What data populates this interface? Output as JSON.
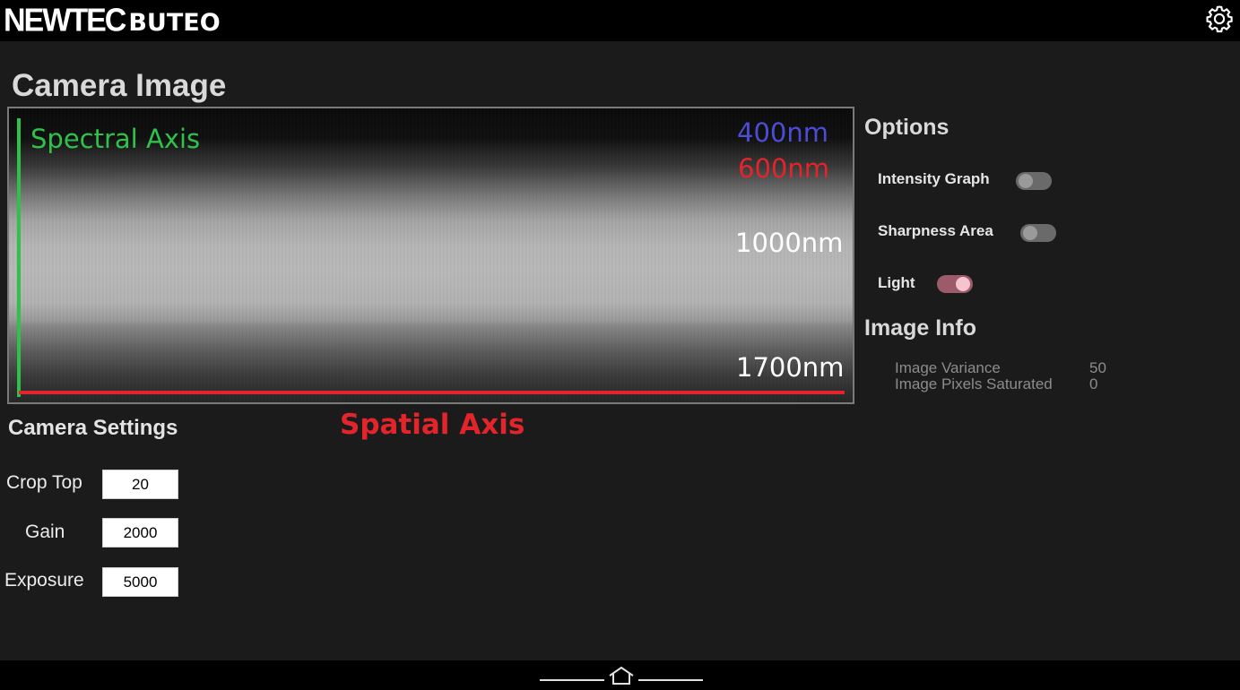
{
  "header": {
    "brand": "NEWTEC",
    "product": "BUTEO",
    "settings_icon": "gear-icon"
  },
  "camera_image": {
    "title": "Camera Image",
    "overlay": {
      "spectral_axis": "Spectral Axis",
      "spatial_axis": "Spatial Axis",
      "wavelengths": [
        "400nm",
        "600nm",
        "1000nm",
        "1700nm"
      ]
    },
    "colors": {
      "spectral_axis": "#2fc24a",
      "spatial_axis": "#e3242b",
      "nm400": "#4b4dd6",
      "nm600": "#e3242b",
      "nm_other": "#ffffff"
    }
  },
  "options": {
    "title": "Options",
    "items": [
      {
        "label": "Intensity Graph",
        "on": false
      },
      {
        "label": "Sharpness Area",
        "on": false
      },
      {
        "label": "Light",
        "on": true
      }
    ],
    "accent_color": "#9c5a6a"
  },
  "image_info": {
    "title": "Image Info",
    "rows": [
      {
        "label": "Image Variance",
        "value": "50"
      },
      {
        "label": "Image Pixels Saturated",
        "value": "0"
      }
    ]
  },
  "camera_settings": {
    "title": "Camera Settings",
    "fields": [
      {
        "label": "Crop Top",
        "value": "20"
      },
      {
        "label": "Gain",
        "value": "2000"
      },
      {
        "label": "Exposure",
        "value": "5000"
      }
    ]
  },
  "footer": {
    "home_icon": "home-icon"
  }
}
